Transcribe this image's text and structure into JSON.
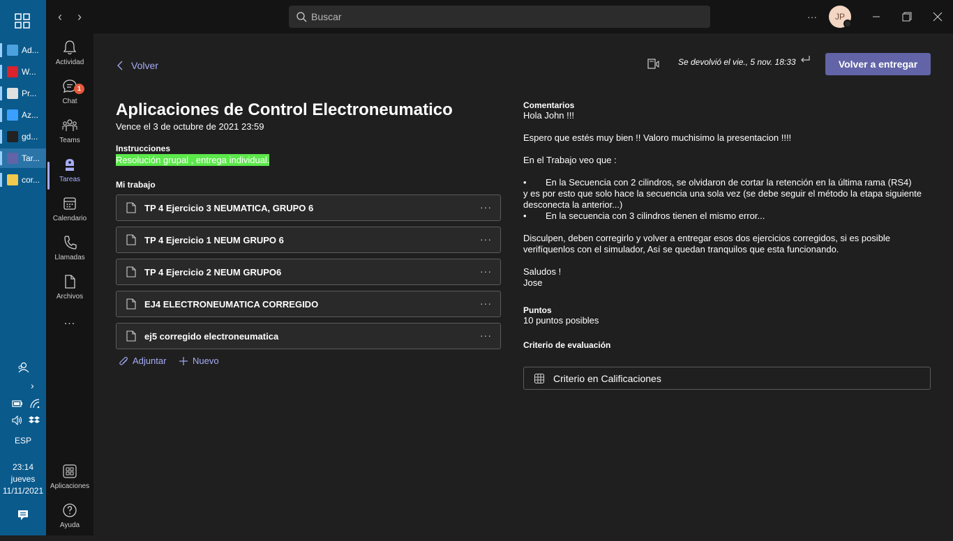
{
  "taskbar": {
    "apps": [
      {
        "label": "Ad...",
        "color": "#4aa3df"
      },
      {
        "label": "W...",
        "color": "#d9232d"
      },
      {
        "label": "Pr...",
        "color": "#e0e0e0"
      },
      {
        "label": "Az...",
        "color": "#3aa0ff"
      },
      {
        "label": "gd...",
        "color": "#222222"
      },
      {
        "label": "Tar...",
        "color": "#6264a7"
      },
      {
        "label": "cor...",
        "color": "#f2c94c"
      }
    ],
    "language": "ESP",
    "time": "23:14",
    "day": "jueves",
    "date": "11/11/2021"
  },
  "appbar": {
    "items": [
      {
        "label": "Actividad",
        "icon": "bell-icon"
      },
      {
        "label": "Chat",
        "icon": "chat-icon",
        "badge": "1"
      },
      {
        "label": "Teams",
        "icon": "teams-icon"
      },
      {
        "label": "Tareas",
        "icon": "assignments-icon",
        "active": true
      },
      {
        "label": "Calendario",
        "icon": "calendar-icon"
      },
      {
        "label": "Llamadas",
        "icon": "phone-icon"
      },
      {
        "label": "Archivos",
        "icon": "file-icon"
      }
    ],
    "more": "...",
    "bottom": [
      {
        "label": "Aplicaciones",
        "icon": "apps-icon"
      },
      {
        "label": "Ayuda",
        "icon": "help-icon"
      }
    ]
  },
  "titlebar": {
    "search_placeholder": "Buscar",
    "avatar_initials": "JP",
    "more": "···"
  },
  "header": {
    "back_label": "Volver",
    "returned_text": "Se devolvió el vie., 5 nov. 18:33",
    "resubmit_label": "Volver a entregar"
  },
  "assignment": {
    "title": "Aplicaciones de Control Electroneumatico",
    "due": "Vence el 3 de octubre de 2021 23:59",
    "instructions_label": "Instrucciones",
    "instructions": "Resolución grupal , entrega individual.",
    "my_work_label": "Mi trabajo",
    "files": [
      "TP 4 Ejercicio 3 NEUMATICA, GRUPO 6",
      "TP 4 Ejercicio 1 NEUM GRUPO 6",
      "TP 4 Ejercicio 2 NEUM GRUPO6",
      "EJ4 ELECTRONEUMATICA CORREGIDO",
      "ej5 corregido electroneumatica"
    ],
    "attach_label": "Adjuntar",
    "new_label": "Nuevo"
  },
  "feedback": {
    "comments_label": "Comentarios",
    "greeting": "Hola John !!!",
    "line1": "Espero que estés muy bien !! Valoro muchisimo la presentacion !!!!",
    "line2": "En el Trabajo veo que :",
    "bullet1": "En la Secuencia con 2 cilindros, se olvidaron de cortar la retención en la última rama (RS4)",
    "bullet1_cont": "y es por esto que solo hace la secuencia una sola vez (se debe seguir el método la etapa siguiente desconecta la anterior...)",
    "bullet2": "En la secuencia con 3 cilindros tienen  el mismo error...",
    "line3": "Disculpen, deben corregirlo y volver a entregar esos dos ejercicios corregidos, si es posible verifíquenlos con el simulador, Así se quedan tranquilos que esta funcionando.",
    "closing": "Saludos  !",
    "signature": "Jose",
    "points_label": "Puntos",
    "points_value": "10 puntos posibles",
    "criteria_label": "Criterio de evaluación",
    "rubric_label": "Criterio en Calificaciones"
  }
}
